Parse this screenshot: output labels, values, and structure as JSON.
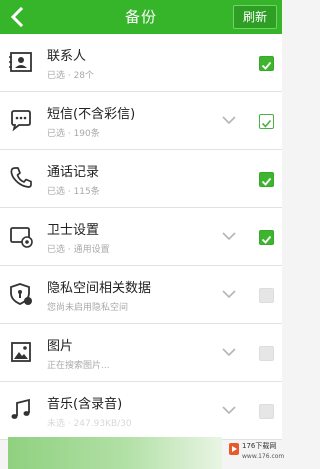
{
  "header": {
    "title": "备份",
    "refresh_label": "刷新",
    "back_icon": "chevron-left-icon"
  },
  "items": [
    {
      "title": "联系人",
      "subtitle": "已选 · 28个",
      "icon": "contact-card-icon",
      "has_chevron": false,
      "checkbox": "checked"
    },
    {
      "title": "短信(不含彩信)",
      "subtitle": "已选 · 190条",
      "icon": "message-bubble-icon",
      "has_chevron": true,
      "checkbox": "outline"
    },
    {
      "title": "通话记录",
      "subtitle": "已选 · 115条",
      "icon": "phone-icon",
      "has_chevron": false,
      "checkbox": "checked"
    },
    {
      "title": "卫士设置",
      "subtitle": "已选 · 通用设置",
      "icon": "device-settings-icon",
      "has_chevron": true,
      "checkbox": "checked"
    },
    {
      "title": "隐私空间相关数据",
      "subtitle": "您尚未启用隐私空间",
      "icon": "privacy-shield-icon",
      "has_chevron": true,
      "checkbox": "disabled"
    },
    {
      "title": "图片",
      "subtitle": "正在搜索图片...",
      "icon": "picture-icon",
      "has_chevron": true,
      "checkbox": "disabled"
    },
    {
      "title": "音乐(含录音)",
      "subtitle": "未选 · 247.93KB/30",
      "icon": "music-note-icon",
      "has_chevron": true,
      "checkbox": "disabled"
    }
  ],
  "watermark": {
    "text": "176下载网",
    "subtext": "www.176.com"
  },
  "colors": {
    "header": "#36b52a",
    "accent": "#3fb52f",
    "background": "#f4f4f4"
  }
}
